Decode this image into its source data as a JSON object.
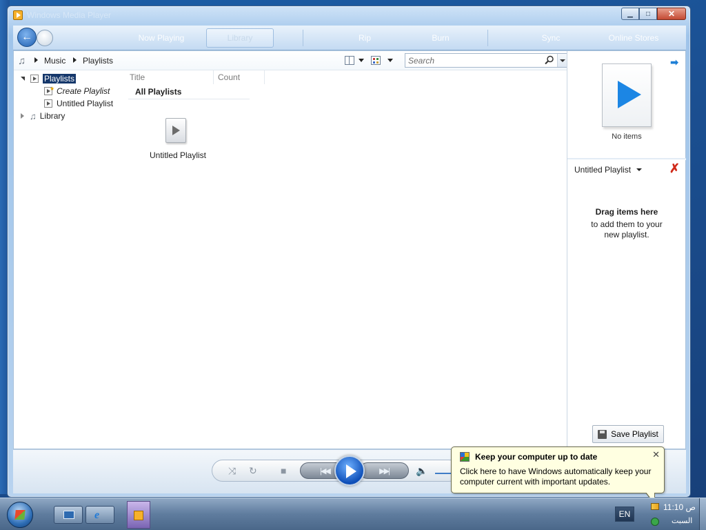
{
  "window": {
    "title": "Windows Media Player"
  },
  "nav": {
    "back_label": "Back",
    "tabs": [
      "Now Playing",
      "Library",
      "Rip",
      "Burn",
      "Sync",
      "Online Stores"
    ]
  },
  "breadcrumb": {
    "items": [
      "Music",
      "Playlists"
    ]
  },
  "search": {
    "placeholder": "Search"
  },
  "tree": {
    "playlists": "Playlists",
    "create_playlist": "Create Playlist",
    "untitled_playlist": "Untitled Playlist",
    "library": "Library"
  },
  "list": {
    "columns": [
      "Title",
      "Count"
    ],
    "group_title": "All Playlists",
    "tiles": [
      {
        "label": "Untitled Playlist"
      }
    ]
  },
  "list_pane": {
    "no_items": "No items",
    "playlist_name": "Untitled Playlist",
    "drag_title": "Drag items here",
    "drag_text": "to add them to your new playlist.",
    "save_button": "Save Playlist"
  },
  "balloon": {
    "title": "Keep your computer up to date",
    "text": "Click here to have Windows automatically keep your computer current with important updates."
  },
  "taskbar": {
    "language": "EN",
    "clock_time": "11:10 ص",
    "clock_day": "السبت"
  },
  "icons": [
    "back-arrow-icon",
    "forward-icon",
    "music-note-icon",
    "layout-icon",
    "view-options-icon",
    "search-icon",
    "playlist-icon",
    "create-playlist-star-icon",
    "library-music-icon",
    "pane-arrow-icon",
    "clear-list-icon",
    "save-disk-icon",
    "shuffle-icon",
    "repeat-icon",
    "stop-icon",
    "previous-icon",
    "play-icon",
    "next-icon",
    "mute-icon",
    "windows-update-icon",
    "windows-start-icon",
    "show-desktop-icon",
    "internet-explorer-icon",
    "media-player-icon"
  ],
  "colors": {
    "accent": "#1c86e4",
    "selection": "#16386b",
    "balloon": "#ffffe1"
  }
}
